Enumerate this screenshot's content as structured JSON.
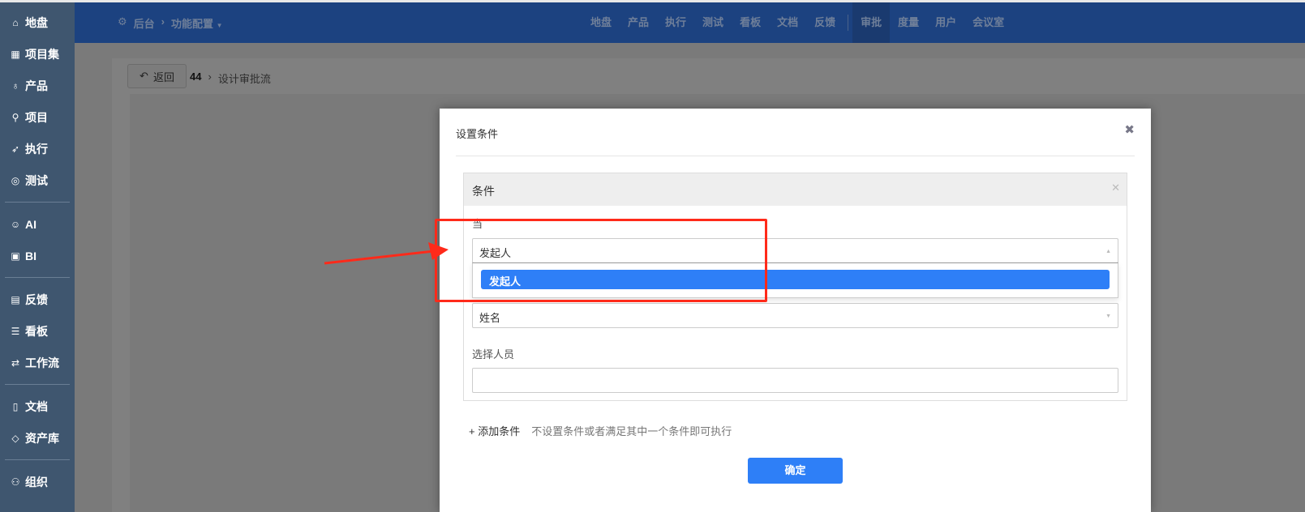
{
  "sidebar": {
    "items": [
      {
        "label": "地盘",
        "icon": "home-icon",
        "glyph": "⌂"
      },
      {
        "label": "项目集",
        "icon": "grid-icon",
        "glyph": "▦"
      },
      {
        "label": "产品",
        "icon": "bulb-icon",
        "glyph": "♁"
      },
      {
        "label": "项目",
        "icon": "rocket-icon",
        "glyph": "⚲"
      },
      {
        "label": "执行",
        "icon": "run-icon",
        "glyph": "➶"
      },
      {
        "label": "测试",
        "icon": "search-icon",
        "glyph": "◎"
      },
      {
        "label": "AI",
        "icon": "robot-icon",
        "glyph": "☺"
      },
      {
        "label": "BI",
        "icon": "presentation-icon",
        "glyph": "▣"
      },
      {
        "label": "反馈",
        "icon": "feedback-icon",
        "glyph": "▤"
      },
      {
        "label": "看板",
        "icon": "kanban-icon",
        "glyph": "☰"
      },
      {
        "label": "工作流",
        "icon": "workflow-icon",
        "glyph": "⇄"
      },
      {
        "label": "文档",
        "icon": "document-icon",
        "glyph": "▯"
      },
      {
        "label": "资产库",
        "icon": "diamond-icon",
        "glyph": "◇"
      },
      {
        "label": "组织",
        "icon": "users-icon",
        "glyph": "⚇"
      }
    ]
  },
  "header": {
    "crumb_root": "后台",
    "crumb_current": "功能配置",
    "nav": [
      "地盘",
      "产品",
      "执行",
      "测试",
      "看板",
      "文档",
      "反馈"
    ],
    "nav2": [
      "审批",
      "度量",
      "用户",
      "会议室"
    ]
  },
  "subbar": {
    "back": "返回",
    "id": "44",
    "title": "设计审批流"
  },
  "modal": {
    "title": "设置条件",
    "condition_title": "条件",
    "when_label": "当",
    "field1_value": "发起人",
    "field1_option": "发起人",
    "field2_value": "姓名",
    "select_people_label": "选择人员",
    "select_people_value": "",
    "add_condition": "+ 添加条件",
    "hint": "不设置条件或者满足其中一个条件即可执行",
    "confirm": "确定"
  },
  "colors": {
    "primary": "#2e7ff7",
    "header": "#1c4280",
    "sidebar": "#3f566f",
    "annotation": "#ff2a1a"
  }
}
